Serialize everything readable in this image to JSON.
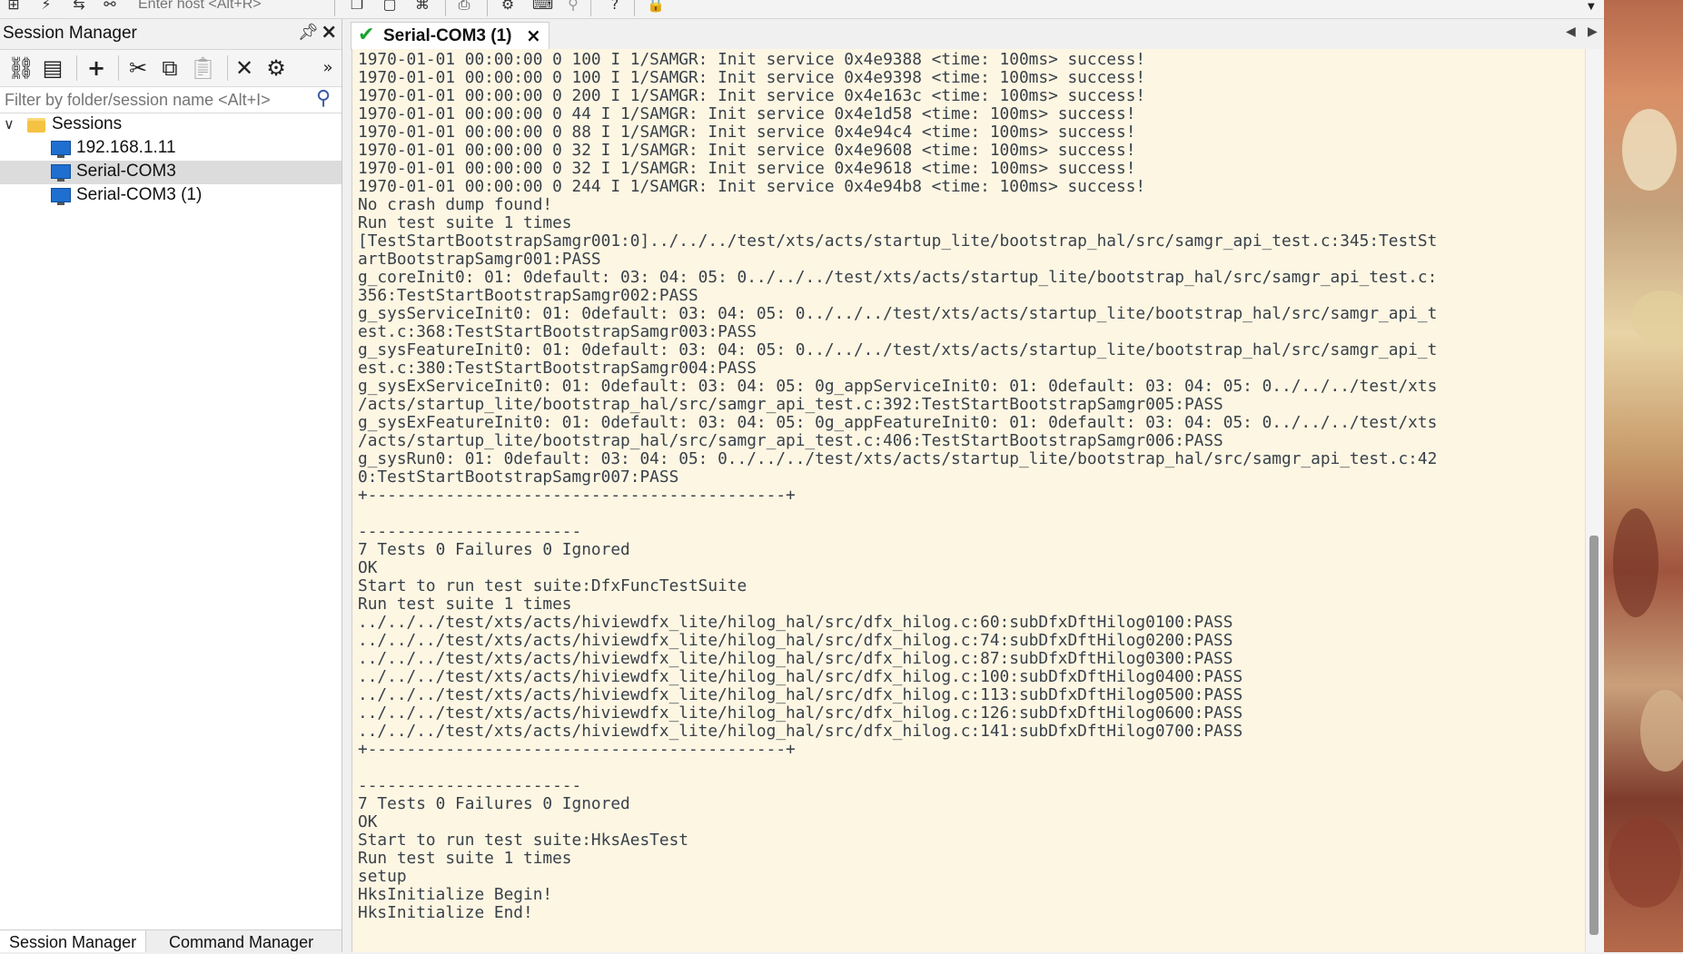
{
  "toolbar": {
    "host_placeholder": "Enter host <Alt+R>",
    "icons": [
      "session-tree-icon",
      "lightning-icon",
      "reconnect-icon",
      "link-icon",
      "clone-icon",
      "copy-icon",
      "binoculars-icon",
      "print-icon",
      "settings-icon",
      "keyboard-icon",
      "pin-icon",
      "help-icon",
      "lock-icon"
    ]
  },
  "session_manager": {
    "title": "Session Manager",
    "filter_placeholder": "Filter by folder/session name <Alt+I>",
    "tree": {
      "folder": "Sessions",
      "items": [
        "192.168.1.11",
        "Serial-COM3",
        "Serial-COM3 (1)"
      ],
      "selected": "Serial-COM3"
    },
    "bottom_tabs": [
      "Session Manager",
      "Command Manager"
    ]
  },
  "session_tab": {
    "title": "Serial-COM3 (1)"
  },
  "terminal": {
    "lines": [
      "1970-01-01 00:00:00 0 100 I 1/SAMGR: Init service 0x4e9388 <time: 100ms> success!",
      "1970-01-01 00:00:00 0 100 I 1/SAMGR: Init service 0x4e9398 <time: 100ms> success!",
      "1970-01-01 00:00:00 0 200 I 1/SAMGR: Init service 0x4e163c <time: 100ms> success!",
      "1970-01-01 00:00:00 0 44 I 1/SAMGR: Init service 0x4e1d58 <time: 100ms> success!",
      "1970-01-01 00:00:00 0 88 I 1/SAMGR: Init service 0x4e94c4 <time: 100ms> success!",
      "1970-01-01 00:00:00 0 32 I 1/SAMGR: Init service 0x4e9608 <time: 100ms> success!",
      "1970-01-01 00:00:00 0 32 I 1/SAMGR: Init service 0x4e9618 <time: 100ms> success!",
      "1970-01-01 00:00:00 0 244 I 1/SAMGR: Init service 0x4e94b8 <time: 100ms> success!",
      "No crash dump found!",
      "Run test suite 1 times",
      "[TestStartBootstrapSamgr001:0]../../../test/xts/acts/startup_lite/bootstrap_hal/src/samgr_api_test.c:345:TestSt",
      "artBootstrapSamgr001:PASS",
      "g_coreInit0: 01: 0default: 03: 04: 05: 0../../../test/xts/acts/startup_lite/bootstrap_hal/src/samgr_api_test.c:",
      "356:TestStartBootstrapSamgr002:PASS",
      "g_sysServiceInit0: 01: 0default: 03: 04: 05: 0../../../test/xts/acts/startup_lite/bootstrap_hal/src/samgr_api_t",
      "est.c:368:TestStartBootstrapSamgr003:PASS",
      "g_sysFeatureInit0: 01: 0default: 03: 04: 05: 0../../../test/xts/acts/startup_lite/bootstrap_hal/src/samgr_api_t",
      "est.c:380:TestStartBootstrapSamgr004:PASS",
      "g_sysExServiceInit0: 01: 0default: 03: 04: 05: 0g_appServiceInit0: 01: 0default: 03: 04: 05: 0../../../test/xts",
      "/acts/startup_lite/bootstrap_hal/src/samgr_api_test.c:392:TestStartBootstrapSamgr005:PASS",
      "g_sysExFeatureInit0: 01: 0default: 03: 04: 05: 0g_appFeatureInit0: 01: 0default: 03: 04: 05: 0../../../test/xts",
      "/acts/startup_lite/bootstrap_hal/src/samgr_api_test.c:406:TestStartBootstrapSamgr006:PASS",
      "g_sysRun0: 01: 0default: 03: 04: 05: 0../../../test/xts/acts/startup_lite/bootstrap_hal/src/samgr_api_test.c:42",
      "0:TestStartBootstrapSamgr007:PASS",
      "+-------------------------------------------+",
      "",
      "-----------------------",
      "7 Tests 0 Failures 0 Ignored",
      "OK",
      "Start to run test suite:DfxFuncTestSuite",
      "Run test suite 1 times",
      "../../../test/xts/acts/hiviewdfx_lite/hilog_hal/src/dfx_hilog.c:60:subDfxDftHilog0100:PASS",
      "../../../test/xts/acts/hiviewdfx_lite/hilog_hal/src/dfx_hilog.c:74:subDfxDftHilog0200:PASS",
      "../../../test/xts/acts/hiviewdfx_lite/hilog_hal/src/dfx_hilog.c:87:subDfxDftHilog0300:PASS",
      "../../../test/xts/acts/hiviewdfx_lite/hilog_hal/src/dfx_hilog.c:100:subDfxDftHilog0400:PASS",
      "../../../test/xts/acts/hiviewdfx_lite/hilog_hal/src/dfx_hilog.c:113:subDfxDftHilog0500:PASS",
      "../../../test/xts/acts/hiviewdfx_lite/hilog_hal/src/dfx_hilog.c:126:subDfxDftHilog0600:PASS",
      "../../../test/xts/acts/hiviewdfx_lite/hilog_hal/src/dfx_hilog.c:141:subDfxDftHilog0700:PASS",
      "+-------------------------------------------+",
      "",
      "-----------------------",
      "7 Tests 0 Failures 0 Ignored",
      "OK",
      "Start to run test suite:HksAesTest",
      "Run test suite 1 times",
      "setup",
      "HksInitialize Begin!",
      "HksInitialize End!"
    ]
  },
  "colors": {
    "terminal_bg": "#fdf6e3",
    "terminal_fg": "#39414a",
    "tab_check": "#17a52f",
    "selection": "#dcdcdc"
  }
}
